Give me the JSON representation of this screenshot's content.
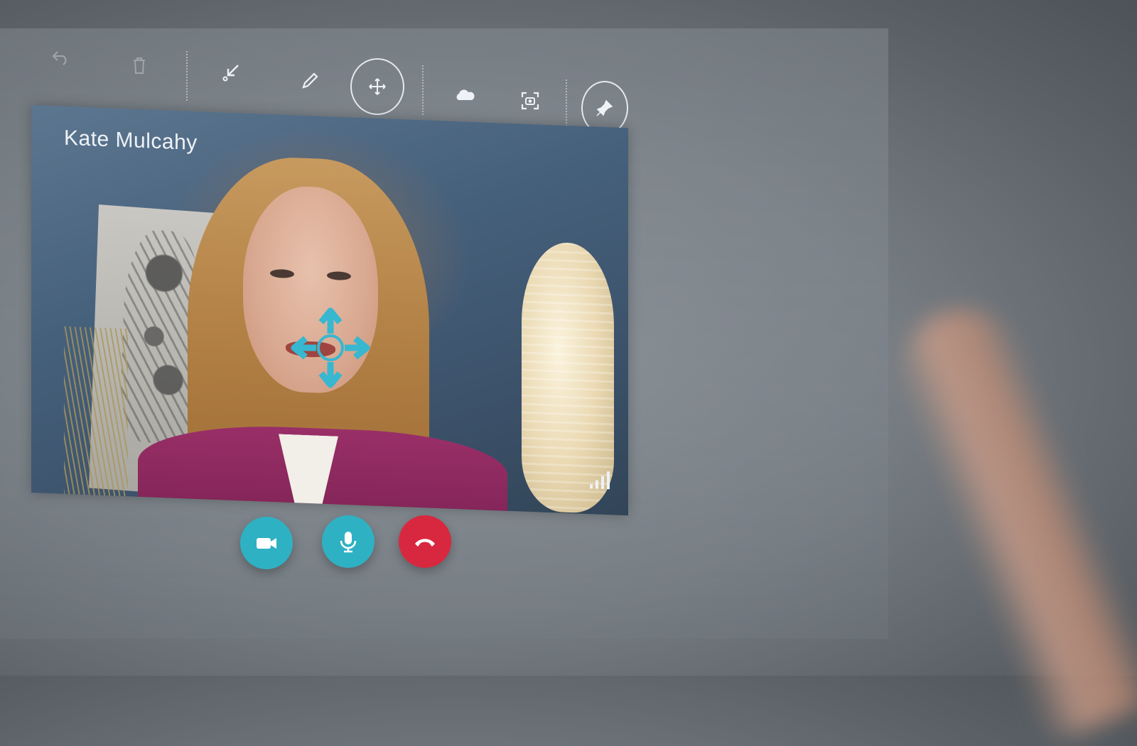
{
  "toolbar": {
    "items": [
      {
        "name": "undo-icon",
        "icon": "undo",
        "enabled": false
      },
      {
        "name": "delete-icon",
        "icon": "trash",
        "enabled": false
      },
      {
        "name": "dock-icon",
        "icon": "arrow-down-left",
        "enabled": true
      },
      {
        "name": "pen-icon",
        "icon": "pencil",
        "enabled": true
      },
      {
        "name": "move-icon",
        "icon": "move-arrows",
        "enabled": true,
        "selected": true
      },
      {
        "name": "cloud-icon",
        "icon": "cloud",
        "enabled": true
      },
      {
        "name": "capture-icon",
        "icon": "camera-frame",
        "enabled": true
      },
      {
        "name": "pin-icon",
        "icon": "pin",
        "enabled": true
      }
    ]
  },
  "call": {
    "caller_name": "Kate Mulcahy",
    "signal_icon": "signal-bars-icon"
  },
  "controls": {
    "video_icon": "video-camera-icon",
    "mic_icon": "microphone-icon",
    "end_call_icon": "hang-up-icon"
  },
  "colors": {
    "accent": "#2fb1c4",
    "end_call": "#d8283f",
    "toolbar_icon": "#eef2f6"
  }
}
